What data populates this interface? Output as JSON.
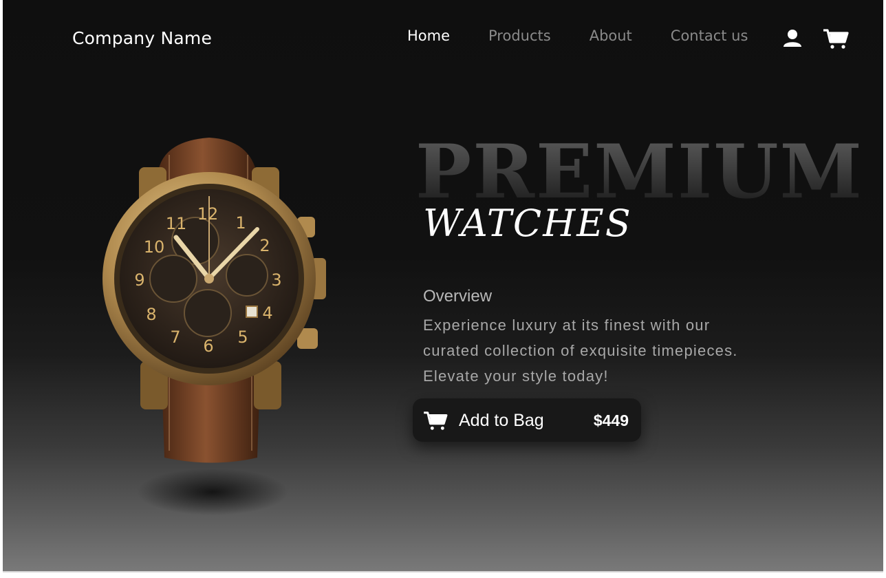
{
  "header": {
    "brand": "Company Name",
    "nav": [
      {
        "label": "Home",
        "active": true
      },
      {
        "label": "Products",
        "active": false
      },
      {
        "label": "About",
        "active": false
      },
      {
        "label": "Contact us",
        "active": false
      }
    ],
    "icons": [
      "user-icon",
      "cart-icon"
    ]
  },
  "hero": {
    "headline": "PREMIUM",
    "subheadline": "WATCHES",
    "overview_title": "Overview",
    "overview_text": "Experience luxury at its finest with our curated collection of exquisite timepieces. Elevate your style today!",
    "add_to_bag_label": "Add to Bag",
    "price": "$449"
  },
  "watch_dial": {
    "numerals": [
      "12",
      "1",
      "2",
      "3",
      "4",
      "5",
      "6",
      "7",
      "8",
      "9",
      "10",
      "11"
    ]
  },
  "colors": {
    "background_top": "#0f0f0f",
    "background_bottom": "#7a7a7a",
    "gold": "#c9a46a",
    "strap": "#6b3d22",
    "nav_inactive": "#8a8a8a"
  }
}
